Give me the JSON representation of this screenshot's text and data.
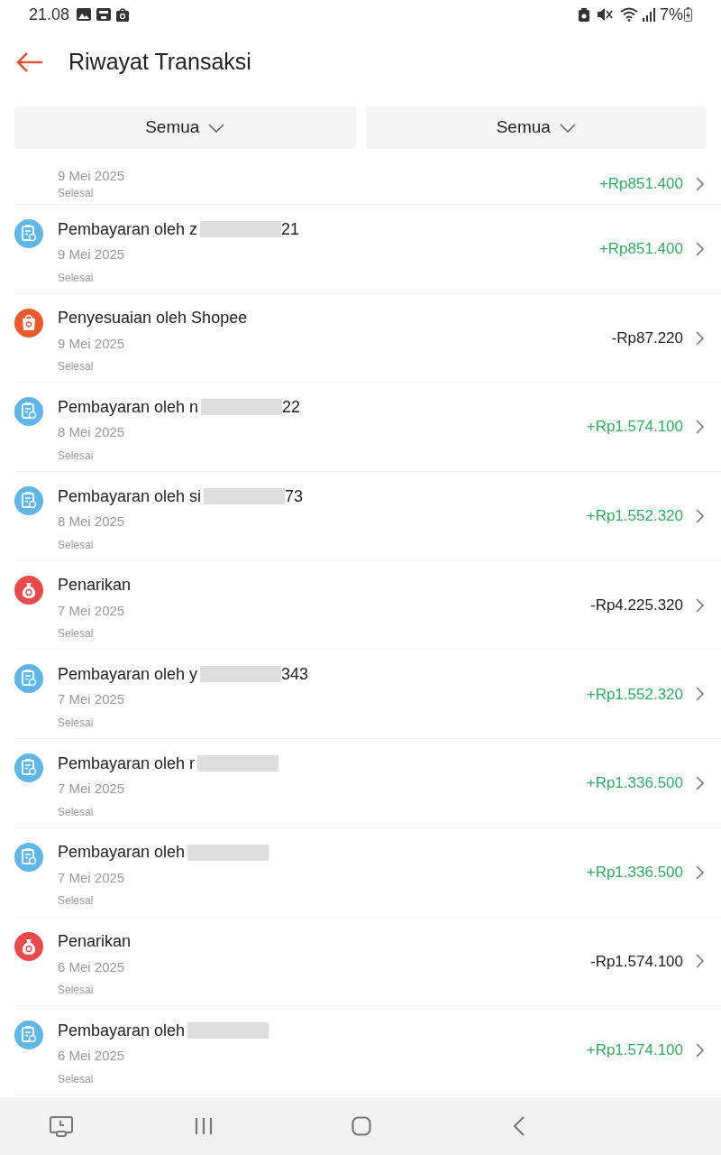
{
  "status_bar": {
    "time": "21.08",
    "battery": "7%"
  },
  "header": {
    "title": "Riwayat Transaksi"
  },
  "filters": [
    {
      "label": "Semua"
    },
    {
      "label": "Semua"
    }
  ],
  "partial_row": {
    "date": "9 Mei 2025",
    "status": "Selesai",
    "amount": "+Rp851.400",
    "color": "#2fae60"
  },
  "transactions": [
    {
      "kind": "payment",
      "title": "Pembayaran oleh z",
      "redacted": true,
      "title_end": "21",
      "date": "9 Mei 2025",
      "status": "Selesai",
      "amount": "+Rp851.400",
      "color": "#2fae60"
    },
    {
      "kind": "adjustment",
      "title": "Penyesuaian oleh Shopee",
      "redacted": false,
      "date": "9 Mei 2025",
      "status": "Selesai",
      "amount": "-Rp87.220",
      "color": "#222222"
    },
    {
      "kind": "payment",
      "title": "Pembayaran oleh n",
      "redacted": true,
      "title_end": "22",
      "date": "8 Mei 2025",
      "status": "Selesai",
      "amount": "+Rp1.574.100",
      "color": "#2fae60"
    },
    {
      "kind": "payment",
      "title": "Pembayaran oleh si",
      "redacted": true,
      "title_end": "73",
      "date": "8 Mei 2025",
      "status": "Selesai",
      "amount": "+Rp1.552.320",
      "color": "#2fae60"
    },
    {
      "kind": "withdrawal",
      "title": "Penarikan",
      "redacted": false,
      "date": "7 Mei 2025",
      "status": "Selesai",
      "amount": "-Rp4.225.320",
      "color": "#222222"
    },
    {
      "kind": "payment",
      "title": "Pembayaran oleh y",
      "redacted": true,
      "title_end": "343",
      "date": "7 Mei 2025",
      "status": "Selesai",
      "amount": "+Rp1.552.320",
      "color": "#2fae60"
    },
    {
      "kind": "payment",
      "title": "Pembayaran oleh r",
      "redacted": true,
      "date": "7 Mei 2025",
      "status": "Selesai",
      "amount": "+Rp1.336.500",
      "color": "#2fae60"
    },
    {
      "kind": "payment",
      "title": "Pembayaran oleh",
      "redacted": true,
      "date": "7 Mei 2025",
      "status": "Selesai",
      "amount": "+Rp1.336.500",
      "color": "#2fae60"
    },
    {
      "kind": "withdrawal",
      "title": "Penarikan",
      "redacted": false,
      "date": "6 Mei 2025",
      "status": "Selesai",
      "amount": "-Rp1.574.100",
      "color": "#222222"
    },
    {
      "kind": "payment",
      "title": "Pembayaran oleh",
      "redacted": true,
      "date": "6 Mei 2025",
      "status": "Selesai",
      "amount": "+Rp1.574.100",
      "color": "#2fae60"
    }
  ]
}
